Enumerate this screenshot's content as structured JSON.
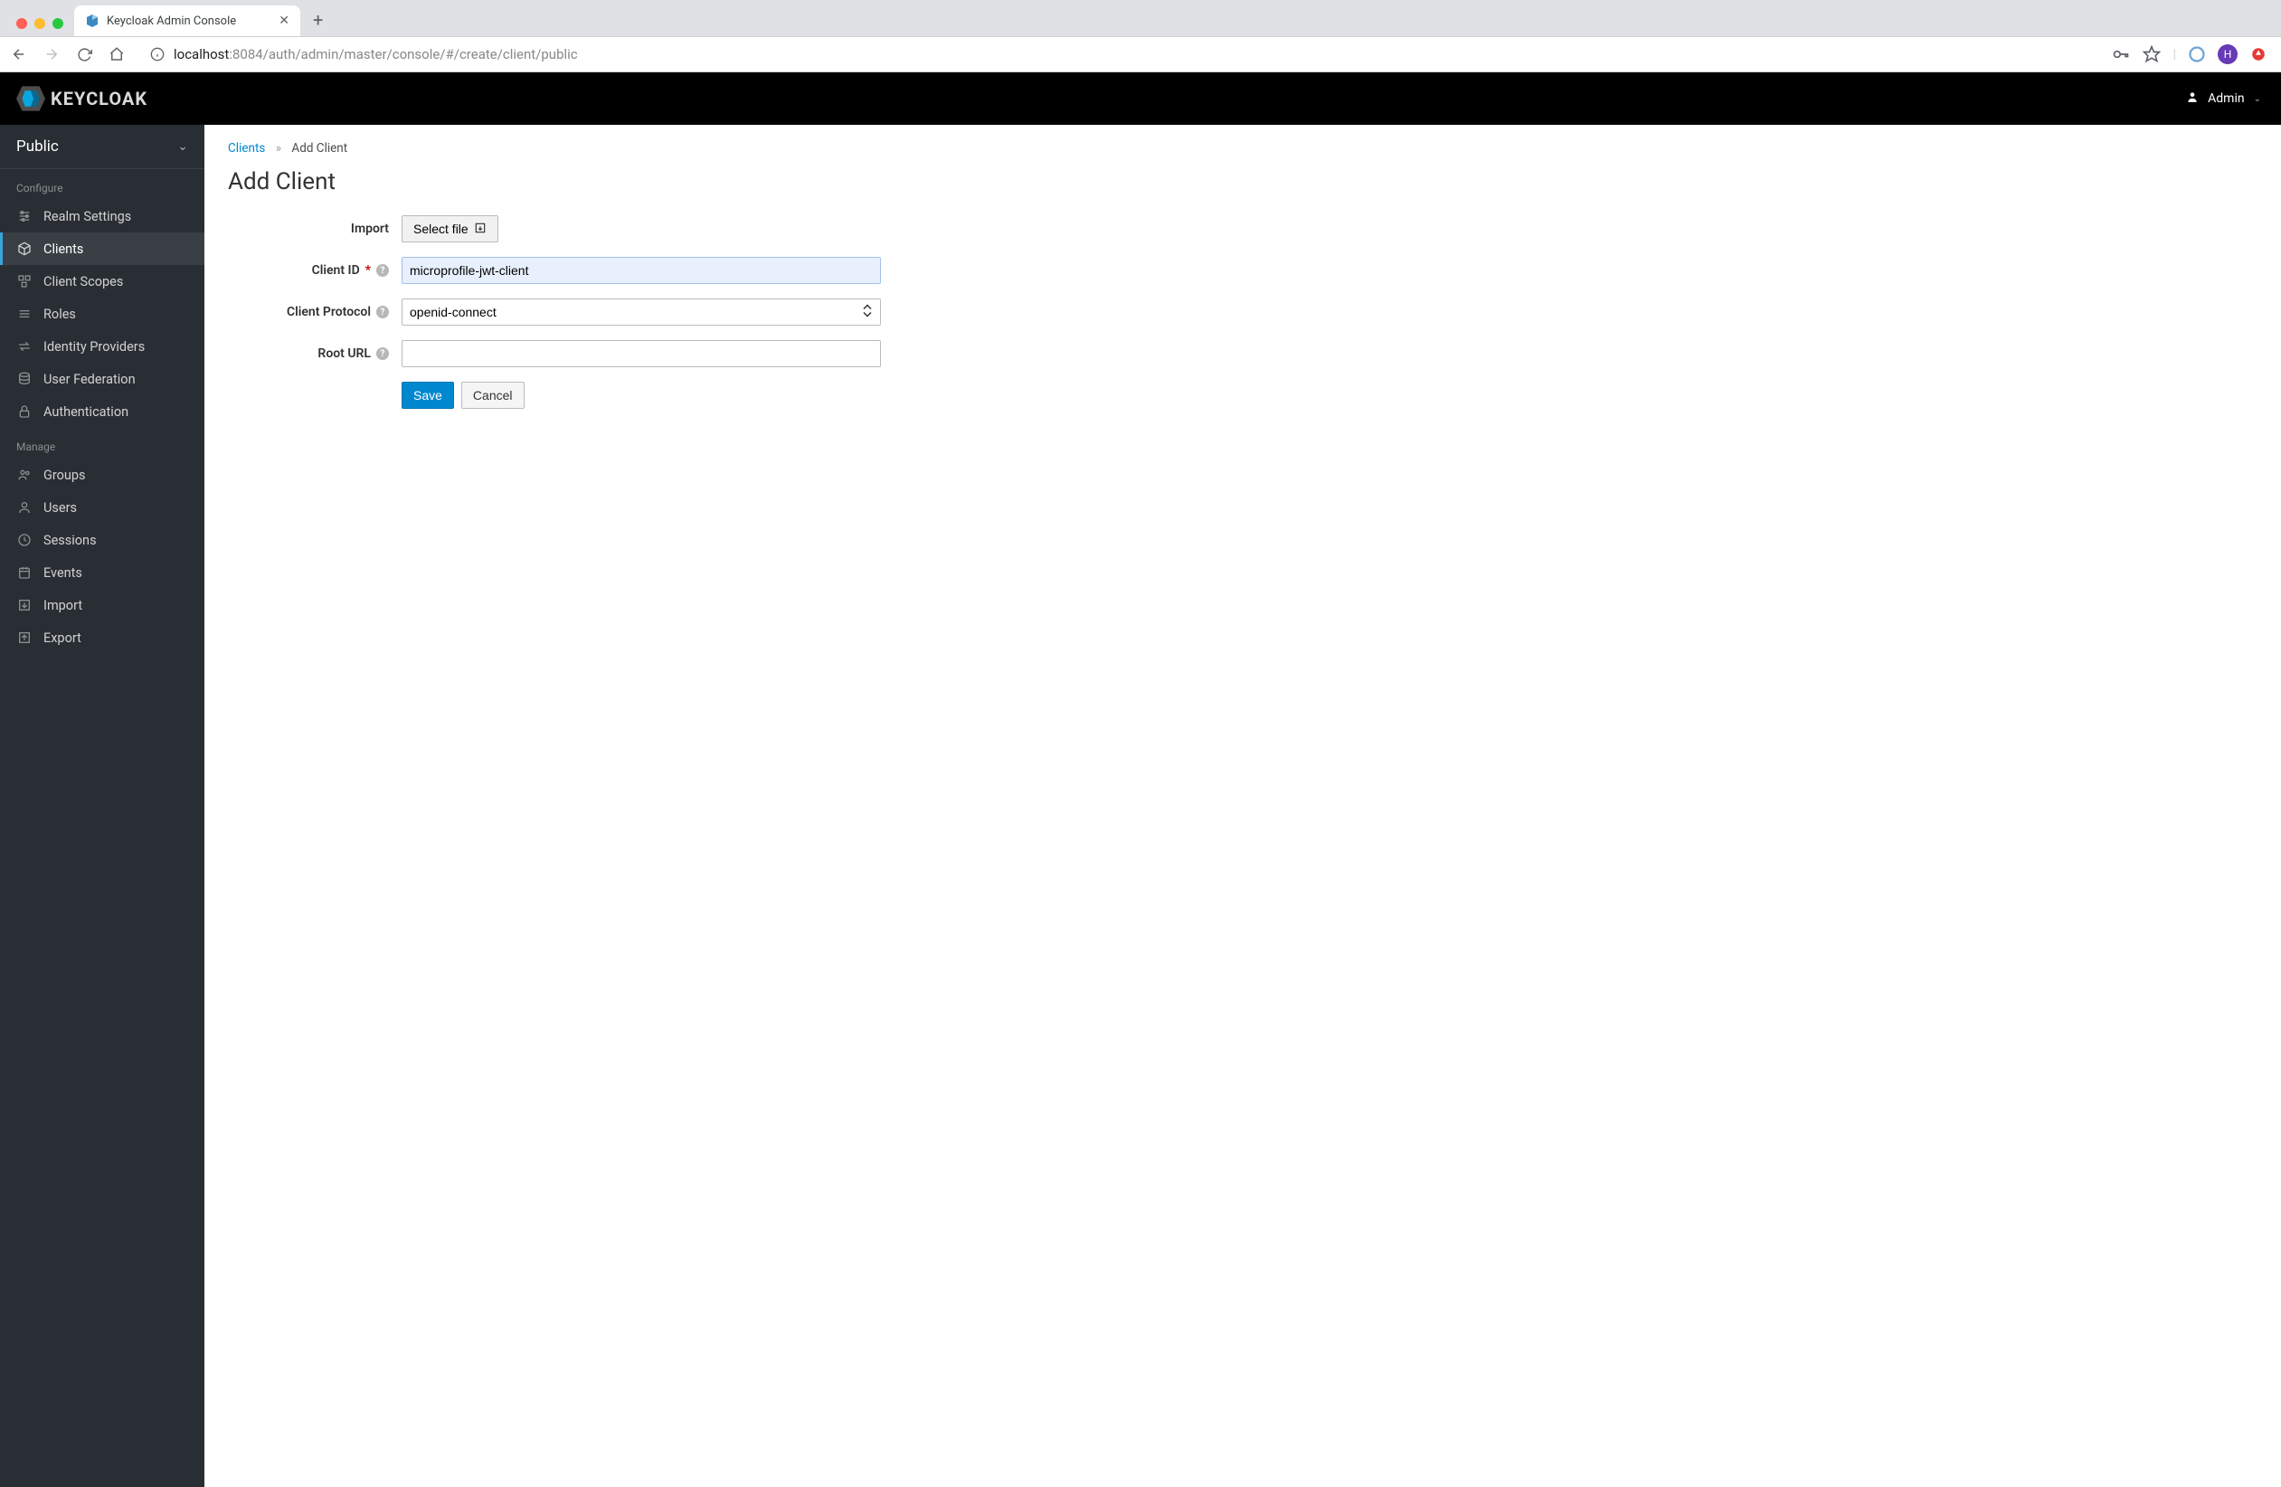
{
  "browser": {
    "tab_title": "Keycloak Admin Console",
    "url_host_prefix": "localhost",
    "url_rest": ":8084/auth/admin/master/console/#/create/client/public",
    "avatar_letter": "H"
  },
  "header": {
    "brand": "KEYCLOAK",
    "user": "Admin"
  },
  "sidebar": {
    "realm": "Public",
    "section_configure": "Configure",
    "section_manage": "Manage",
    "configure_items": [
      {
        "label": "Realm Settings"
      },
      {
        "label": "Clients"
      },
      {
        "label": "Client Scopes"
      },
      {
        "label": "Roles"
      },
      {
        "label": "Identity Providers"
      },
      {
        "label": "User Federation"
      },
      {
        "label": "Authentication"
      }
    ],
    "manage_items": [
      {
        "label": "Groups"
      },
      {
        "label": "Users"
      },
      {
        "label": "Sessions"
      },
      {
        "label": "Events"
      },
      {
        "label": "Import"
      },
      {
        "label": "Export"
      }
    ]
  },
  "breadcrumb": {
    "parent": "Clients",
    "current": "Add Client"
  },
  "page": {
    "title": "Add Client"
  },
  "form": {
    "import_label": "Import",
    "select_file_label": "Select file",
    "client_id_label": "Client ID",
    "client_id_value": "microprofile-jwt-client",
    "client_protocol_label": "Client Protocol",
    "client_protocol_value": "openid-connect",
    "root_url_label": "Root URL",
    "root_url_value": "",
    "save_label": "Save",
    "cancel_label": "Cancel"
  }
}
